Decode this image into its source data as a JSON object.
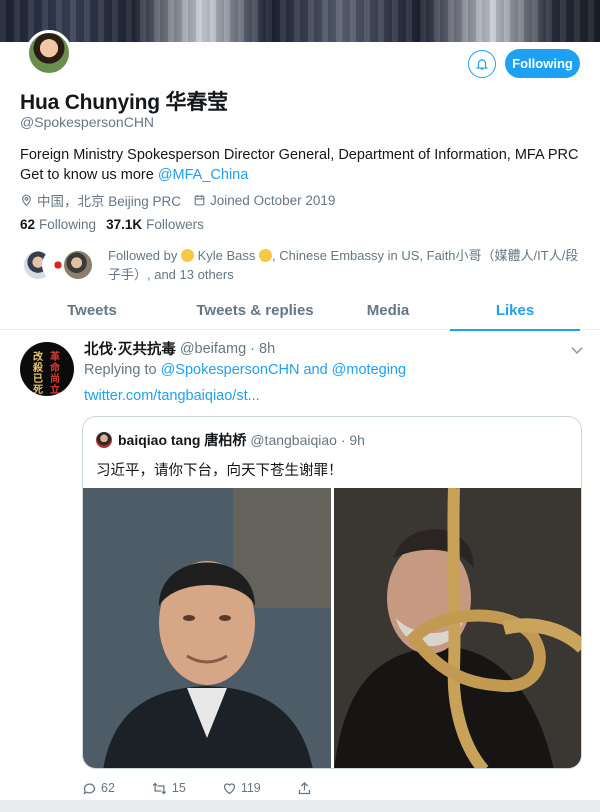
{
  "profile": {
    "name": "Hua Chunying 华春莹",
    "handle": "@SpokespersonCHN",
    "bio_text": "Foreign Ministry Spokesperson Director General, Department of Information, MFA PRC Get to know us more ",
    "bio_link": "@MFA_China",
    "location": "中国，北京 Beijing PRC",
    "joined": "Joined October 2019",
    "following_count": "62",
    "following_label": "Following",
    "followers_count": "37.1K",
    "followers_label": "Followers",
    "follow_button_label": "Following",
    "followed_by_prefix": "Followed by ",
    "followed_by_name1": " Kyle Bass ",
    "followed_by_rest": ", Chinese Embassy in US, Faith小哥（媒體人/IT人/段子手）, and 13 others"
  },
  "tabs": [
    {
      "label": "Tweets"
    },
    {
      "label": "Tweets & replies"
    },
    {
      "label": "Media"
    },
    {
      "label": "Likes",
      "active": true
    }
  ],
  "tweet": {
    "display_name": "北伐·灭共抗毒",
    "handle_time": "@beifamg · 8h",
    "avatar_glyphs_left": "改殺已死",
    "avatar_glyphs_right": "革命尚立",
    "reply_prefix": "Replying to ",
    "reply_user1": "@SpokespersonCHN",
    "reply_and": " and ",
    "reply_user2": "@moteging",
    "link": "twitter.com/tangbaiqiao/st...",
    "quote": {
      "display_name": "baiqiao tang 唐柏桥",
      "handle_time": "@tangbaiqiao · 9h",
      "text": "习近平，请你下台，向天下苍生谢罪！"
    },
    "actions": {
      "replies": "62",
      "retweets": "15",
      "likes": "119"
    }
  },
  "colors": {
    "accent": "#1da1f2",
    "muted": "#657786",
    "text": "#14171a"
  }
}
